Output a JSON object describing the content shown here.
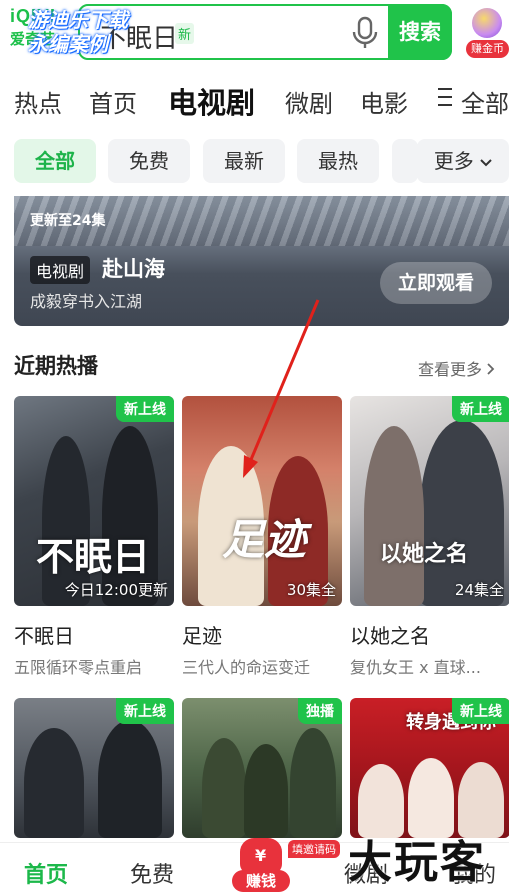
{
  "header": {
    "logo_line1": "iQIYI",
    "logo_line2": "爱奇艺",
    "watermark": [
      "游迪乐下载",
      "永编案例"
    ],
    "search_placeholder": "不眠日",
    "search_new_badge": "新",
    "search_button": "搜索",
    "coin_label": "赚金币"
  },
  "nav": {
    "tabs": [
      "热点",
      "首页",
      "电视剧",
      "微剧",
      "电影",
      "全部"
    ],
    "active": "电视剧",
    "all_icon": "hamburger-icon"
  },
  "filters": {
    "chips": [
      "全部",
      "免费",
      "最新",
      "最热"
    ],
    "more": "更多",
    "selected": "全部"
  },
  "banner": {
    "update": "更新至24集",
    "badge": "电视剧",
    "title": "赴山海",
    "subtitle": "成毅穿书入江湖",
    "cta": "立即观看"
  },
  "section": {
    "title": "近期热播",
    "more": "查看更多"
  },
  "cards": [
    {
      "corner": "新上线",
      "caption": "今日12:00更新",
      "art": "不眠日",
      "title": "不眠日",
      "subtitle": "五限循环零点重启"
    },
    {
      "corner": "",
      "caption": "30集全",
      "art": "足迹",
      "title": "足迹",
      "subtitle": "三代人的命运变迁"
    },
    {
      "corner": "新上线",
      "caption": "24集全",
      "art": "以她之名",
      "title": "以她之名",
      "subtitle": "复仇女王 x 直球..."
    }
  ],
  "cards_row2": [
    {
      "corner": "新上线"
    },
    {
      "corner": "独播"
    },
    {
      "corner": "新上线",
      "art": "转身遇到你"
    }
  ],
  "bottom_bar": {
    "items": [
      "首页",
      "免费",
      "赚钱",
      "微剧",
      "我的"
    ],
    "active": "首页",
    "invite_badge": "填邀请码",
    "corner_watermark": "大玩客"
  },
  "colors": {
    "accent": "#20c34a",
    "red": "#e8323c",
    "annotation_arrow": "#e0211b"
  }
}
